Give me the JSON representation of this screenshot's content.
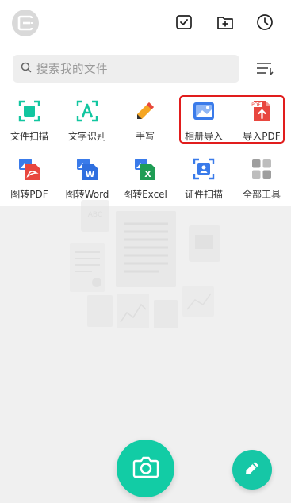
{
  "header": {
    "logo_icon": "app-logo-icon",
    "actions": [
      {
        "name": "select-all",
        "icon": "checkbox-icon"
      },
      {
        "name": "new-folder",
        "icon": "folder-add-icon"
      },
      {
        "name": "history",
        "icon": "clock-icon"
      }
    ]
  },
  "search": {
    "placeholder": "搜索我的文件",
    "icon": "search-icon",
    "sort_icon": "sort-icon"
  },
  "tools_row1": [
    {
      "label": "文件扫描",
      "icon": "scan-doc-icon",
      "color": "#12c6a0"
    },
    {
      "label": "文字识别",
      "icon": "ocr-text-icon",
      "color": "#12c6a0"
    },
    {
      "label": "手写",
      "icon": "pencil-icon",
      "color": "#f5a623"
    },
    {
      "label": "相册导入",
      "icon": "album-import-icon",
      "color": "#3a7bea"
    },
    {
      "label": "导入PDF",
      "icon": "pdf-import-icon",
      "color": "#e8473f"
    }
  ],
  "tools_row2": [
    {
      "label": "图转PDF",
      "icon": "image-to-pdf-icon",
      "color": "#e8473f"
    },
    {
      "label": "图转Word",
      "icon": "image-to-word-icon",
      "color": "#2f6fdf"
    },
    {
      "label": "图转Excel",
      "icon": "image-to-excel-icon",
      "color": "#1f9d55"
    },
    {
      "label": "证件扫描",
      "icon": "id-scan-icon",
      "color": "#3a7bea"
    },
    {
      "label": "全部工具",
      "icon": "all-tools-icon",
      "color": "#9e9e9e"
    }
  ],
  "illustration": {
    "abc_text": "ABC"
  },
  "fab": {
    "camera_icon": "camera-icon",
    "pen_icon": "pen-icon",
    "accent": "#12cca5"
  }
}
